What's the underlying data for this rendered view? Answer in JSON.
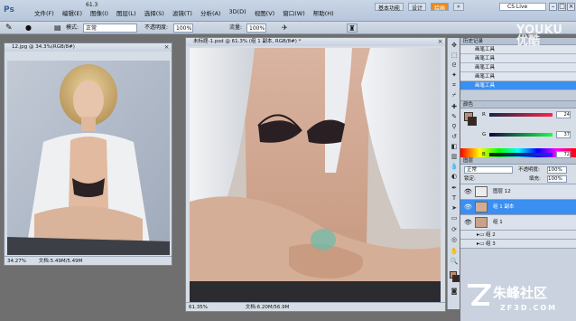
{
  "app": {
    "logo": "Ps"
  },
  "menu": {
    "items": [
      "文件(F)",
      "编辑(E)",
      "图像(I)",
      "图层(L)",
      "选择(S)",
      "滤镜(T)",
      "分析(A)",
      "3D(D)",
      "视图(V)",
      "窗口(W)",
      "帮助(H)"
    ],
    "zoom": "61.3"
  },
  "workspace": {
    "buttons": [
      "基本功能",
      "设计",
      "绘画",
      "»"
    ],
    "active_index": 2,
    "search_label": "CS Live"
  },
  "options": {
    "mode_label": "模式:",
    "mode_value": "正常",
    "opacity_label": "不透明度:",
    "opacity_value": "100%",
    "flow_label": "流量:",
    "flow_value": "100%"
  },
  "doc1": {
    "title": "12.jpg @ 34.3%(RGB/8#)",
    "zoom": "34.27%",
    "info": "文档:5.49M/5.49M"
  },
  "doc2": {
    "title": "未标题-1.psd @ 61.3% (组 1 副本, RGB/8#) *",
    "zoom": "61.35%",
    "info": "文档:6.20M/56.9M"
  },
  "panels": {
    "history": {
      "tab": "历史记录",
      "items": [
        "画笔工具",
        "画笔工具",
        "画笔工具",
        "画笔工具",
        "画笔工具"
      ],
      "selected_index": 4
    },
    "color": {
      "tab": "颜色",
      "channels": [
        {
          "label": "R",
          "value": "24"
        },
        {
          "label": "G",
          "value": "37"
        },
        {
          "label": "B",
          "value": "72"
        }
      ],
      "swatches_tab": "色板"
    },
    "layers": {
      "tab": "图层",
      "blend": "正常",
      "opacity_label": "不透明度:",
      "opacity_value": "100%",
      "fill_label": "填充:",
      "fill_value": "100%",
      "lock_label": "锁定:",
      "items": [
        {
          "name": "图层 12",
          "kind": "layer",
          "selected": false
        },
        {
          "name": "组 1 副本",
          "kind": "layer",
          "selected": true
        },
        {
          "name": "组 1",
          "kind": "layer",
          "selected": false
        },
        {
          "name": "组 2",
          "kind": "group",
          "selected": false
        },
        {
          "name": "组 3",
          "kind": "group",
          "selected": false
        }
      ]
    }
  },
  "watermarks": {
    "top_line1": "YOUKU",
    "top_line2": "优酷",
    "bottom_main": "朱峰社区",
    "bottom_sub": "ZF3D.COM"
  },
  "colors": {
    "highlight": "#3a8ff0",
    "active_workspace": "#e88a1d",
    "foreground": "#bf8d6e",
    "background": "#3a2620"
  }
}
